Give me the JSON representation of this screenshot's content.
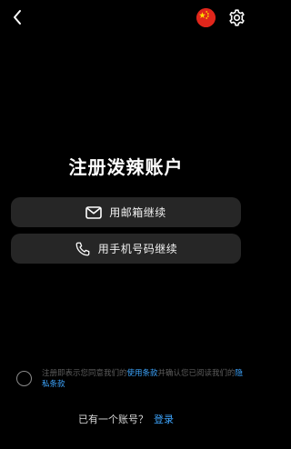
{
  "header": {
    "back_icon": "chevron-left-icon",
    "region_icon": "china-flag-icon",
    "settings_icon": "gear-icon"
  },
  "main": {
    "title": "注册泼辣账户",
    "email_button_label": "用邮箱继续",
    "email_button_icon": "envelope-icon",
    "phone_button_label": "用手机号码继续",
    "phone_button_icon": "phone-icon"
  },
  "terms": {
    "prefix": "注册即表示您同意我们的",
    "terms_link": "使用条款",
    "middle": "并确认您已阅读我们的",
    "privacy_link": "隐私条款",
    "checked": false
  },
  "footer": {
    "prompt": "已有一个账号？",
    "login_label": "登录"
  },
  "colors": {
    "background": "#000000",
    "button_bg": "#262626",
    "link": "#3ea6ff",
    "flag_red": "#e0261b",
    "flag_star": "#ffde00"
  }
}
